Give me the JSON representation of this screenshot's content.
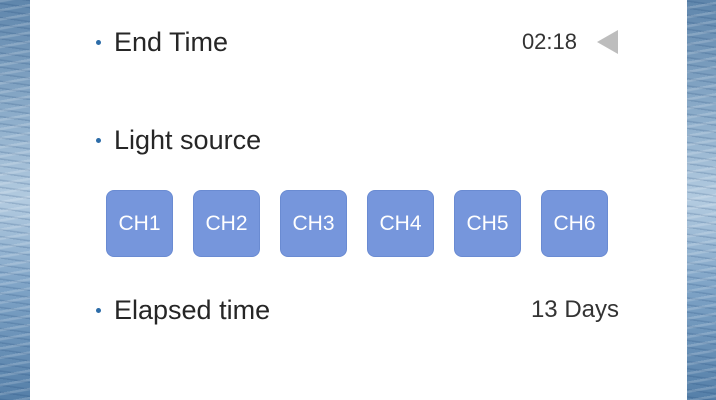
{
  "end_time": {
    "label": "End Time",
    "value": "02:18",
    "toggle_icon": "triangle-left-icon"
  },
  "light_source": {
    "label": "Light source",
    "channels": [
      "CH1",
      "CH2",
      "CH3",
      "CH4",
      "CH5",
      "CH6"
    ],
    "channel_color": "#7696dc"
  },
  "elapsed_time": {
    "label": "Elapsed time",
    "value": "13 Days"
  },
  "colors": {
    "bullet": "#2c6ca8",
    "card": "#ffffff"
  }
}
